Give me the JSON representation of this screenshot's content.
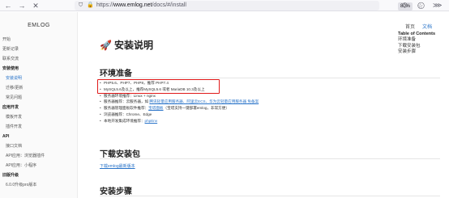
{
  "browser": {
    "back_icon": "←",
    "forward_icon": "→",
    "close_icon": "✕",
    "url_host": "www.emlog.net",
    "url_prefix": "https://",
    "url_path": "/docs/#/install",
    "zoom": "80%",
    "star_icon": "☆"
  },
  "sidebar": {
    "brand": "EMLOG",
    "items": [
      {
        "label": "开始",
        "kind": "l0"
      },
      {
        "label": "更新记录",
        "kind": "l0"
      },
      {
        "label": "联系交流",
        "kind": "l0"
      },
      {
        "label": "安装使用",
        "kind": "section"
      },
      {
        "label": "安装说明",
        "kind": "l1 active"
      },
      {
        "label": "迁移/更新",
        "kind": "l1"
      },
      {
        "label": "常见问题",
        "kind": "l1"
      },
      {
        "label": "应用开发",
        "kind": "section"
      },
      {
        "label": "模板开发",
        "kind": "l1"
      },
      {
        "label": "插件开发",
        "kind": "l1"
      },
      {
        "label": "API",
        "kind": "section"
      },
      {
        "label": "接口文档",
        "kind": "l1"
      },
      {
        "label": "API应用：浏览器插件",
        "kind": "l1"
      },
      {
        "label": "API应用：小程序",
        "kind": "l1"
      },
      {
        "label": "旧版升级",
        "kind": "section"
      },
      {
        "label": "6.0.0升级pro版本",
        "kind": "l1"
      }
    ]
  },
  "main": {
    "title_icon": "🚀",
    "title": "安装说明",
    "env_heading": "环境准备",
    "env_items": [
      {
        "pre": "PHP5.6、PHP7、PHP8，推荐 PHP7.4",
        "link": "",
        "post": ""
      },
      {
        "pre": "MySQL5.6及以上，推荐MySQL5.6 或者 MariaDB 10.3及以上",
        "link": "",
        "post": ""
      },
      {
        "pre": "服务器环境推荐：Linux + nginx",
        "link": "",
        "post": ""
      },
      {
        "pre": "服务器推荐：云服务器，如 ",
        "link": "腾讯轻量应用服务器、阿里云ECS、华为云轻量应用服务器 免备案",
        "post": ""
      },
      {
        "pre": "服务器管理面板软件推荐：",
        "link": "宝塔面板",
        "post": "（宝塔支持一键部署emlog，非常方便）"
      },
      {
        "pre": "浏览器推荐：Chrome、Edge",
        "link": "",
        "post": ""
      },
      {
        "pre": "本地开发集成环境推荐：",
        "link": "phpEnv",
        "post": ""
      }
    ],
    "download_heading": "下载安装包",
    "download_link": "下载emlog最新版本",
    "steps_heading": "安装步骤"
  },
  "toc": {
    "home": "首页",
    "docs": "文档",
    "title": "Table of Contents",
    "items": [
      "环境准备",
      "下载安装包",
      "安装步骤"
    ]
  }
}
